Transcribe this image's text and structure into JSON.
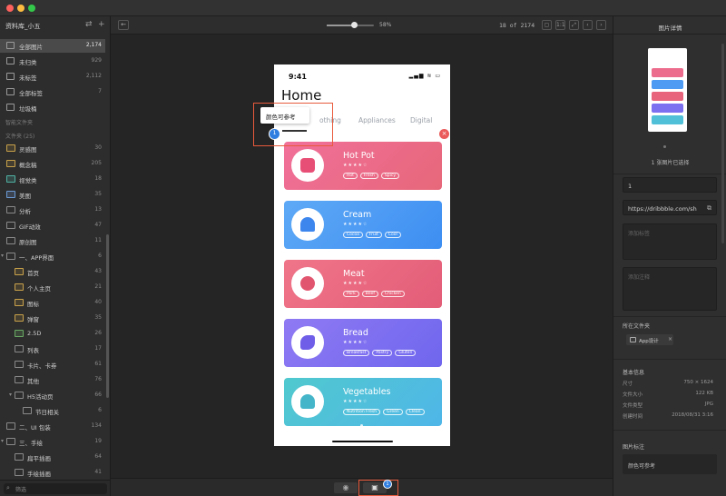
{
  "sidebar": {
    "library_title": "资料库_小五",
    "top_items": [
      {
        "label": "全部图片",
        "count": "2,174"
      },
      {
        "label": "未归类",
        "count": "929"
      },
      {
        "label": "未标签",
        "count": "2,112"
      },
      {
        "label": "全部标签",
        "count": "7"
      },
      {
        "label": "垃圾桶",
        "count": ""
      }
    ],
    "smart_folders_label": "智能文件夹",
    "folders_label": "文件夹 (25)",
    "folders": [
      {
        "label": "灵感图",
        "count": "30"
      },
      {
        "label": "概念稿",
        "count": "205"
      },
      {
        "label": "视觉类",
        "count": "18"
      },
      {
        "label": "美图",
        "count": "35"
      },
      {
        "label": "分析",
        "count": "13"
      },
      {
        "label": "GIF动效",
        "count": "47"
      },
      {
        "label": "原创图",
        "count": "11"
      },
      {
        "label": "一、APP界面",
        "count": "6"
      },
      {
        "label": "首页",
        "count": "43"
      },
      {
        "label": "个人主页",
        "count": "21"
      },
      {
        "label": "图标",
        "count": "40"
      },
      {
        "label": "弹窗",
        "count": "35"
      },
      {
        "label": "2.5D",
        "count": "26"
      },
      {
        "label": "列表",
        "count": "17"
      },
      {
        "label": "卡片、卡券",
        "count": "61"
      },
      {
        "label": "其他",
        "count": "76"
      },
      {
        "label": "H5活动页",
        "count": "66"
      },
      {
        "label": "节日相关",
        "count": "6"
      },
      {
        "label": "二、UI 包装",
        "count": "134"
      },
      {
        "label": "三、手绘",
        "count": "19"
      },
      {
        "label": "扁平插画",
        "count": "64"
      },
      {
        "label": "手绘插画",
        "count": "41"
      },
      {
        "label": "四、…",
        "count": ""
      }
    ],
    "filter_placeholder": "筛选"
  },
  "toolbar": {
    "back_icon": "←",
    "zoom_label": "58%",
    "zoom_value": 0.58,
    "page_counter": "18 of 2174"
  },
  "phone": {
    "time": "9:41",
    "status": "▂▄▆ ≋ ▭",
    "home_title": "Home",
    "tabs": [
      "othing",
      "Appliances",
      "Digital"
    ],
    "cards": [
      {
        "title": "Hot Pot",
        "tags": [
          "Hot",
          "Fresh",
          "Spicy"
        ],
        "color1": "#f0709a",
        "color2": "#e7677a"
      },
      {
        "title": "Cream",
        "tags": [
          "Cocoa",
          "Fruit",
          "Cool"
        ],
        "color1": "#5ea9f6",
        "color2": "#3d8ef2"
      },
      {
        "title": "Meat",
        "tags": [
          "Pork",
          "Beef",
          "Chicken"
        ],
        "color1": "#f07589",
        "color2": "#e35d78"
      },
      {
        "title": "Bread",
        "tags": [
          "Breakfast",
          "Pastry",
          "Gluten"
        ],
        "color1": "#8f7af3",
        "color2": "#6f66ee"
      },
      {
        "title": "Vegetables",
        "tags": [
          "Nutrition Fresh",
          "Green",
          "Clean"
        ],
        "color1": "#50c9ce",
        "color2": "#4fb6e8"
      }
    ]
  },
  "annotation": {
    "text": "颜色可参考",
    "badge": "1",
    "close_icon": "×"
  },
  "bottombar": {
    "eye_icon": "◉",
    "comment_icon": "▣",
    "comment_badge": "1"
  },
  "right": {
    "title": "图片详情",
    "selected_text": "1 张图片已选择",
    "name_value": "1",
    "url_value": "https://dribbble.com/sh",
    "tag_placeholder": "添加标签",
    "note_placeholder": "添加注释",
    "folder_section": "所在文件夹",
    "folder_chip": "App设计",
    "folder_chip_remove": "×",
    "basic_info": "基本信息",
    "info": [
      {
        "key": "尺寸",
        "value": "750 × 1624"
      },
      {
        "key": "文件大小",
        "value": "122 KB"
      },
      {
        "key": "文件类型",
        "value": "JPG"
      },
      {
        "key": "创建时间",
        "value": "2018/08/31 3:16"
      }
    ],
    "annot_section": "图片标注",
    "annot_item": "颜色可参考"
  },
  "colors": {
    "accent_red": "#e85a3c",
    "badge_blue": "#2f7ee0",
    "traffic_red": "#fc615d",
    "traffic_yellow": "#fdbc40",
    "traffic_green": "#34c84a"
  }
}
